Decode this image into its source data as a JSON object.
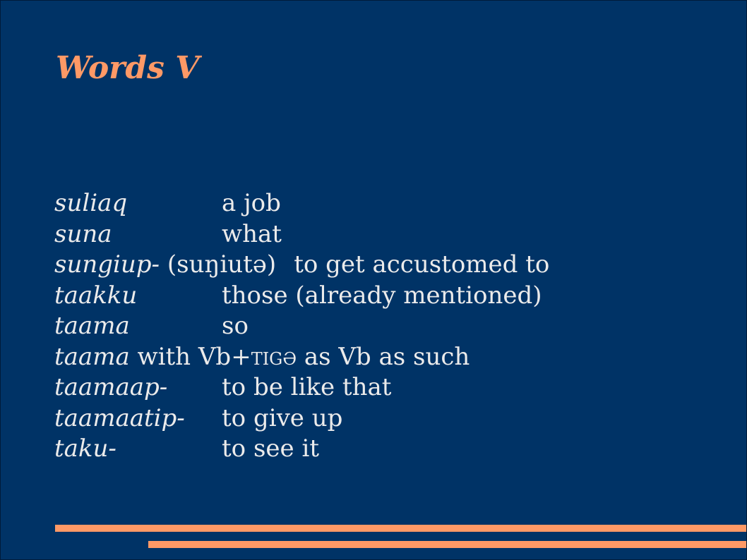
{
  "slide": {
    "title": "Words V",
    "entries": [
      {
        "term": "suliaq",
        "gloss": "a job"
      },
      {
        "term": "suna",
        "gloss": "what"
      },
      {
        "term": "sungiup-",
        "pronunciation": " (suŋiutə)",
        "gloss": "to get accustomed to"
      },
      {
        "term": "taakku",
        "gloss": "those (already mentioned)"
      },
      {
        "term": "taama",
        "gloss": "so"
      },
      {
        "term": "taama",
        "text_before": " with Vb+",
        "suffix": "tigə",
        "text_after": " as Vb as such"
      },
      {
        "term": "taamaap-",
        "gloss": "to be like that"
      },
      {
        "term": "taamaatip-",
        "gloss": "to give up"
      },
      {
        "term": "taku-",
        "gloss": "to see it"
      }
    ]
  },
  "colors": {
    "background": "#003366",
    "accent": "#ff9966",
    "text": "#ebebeb"
  }
}
